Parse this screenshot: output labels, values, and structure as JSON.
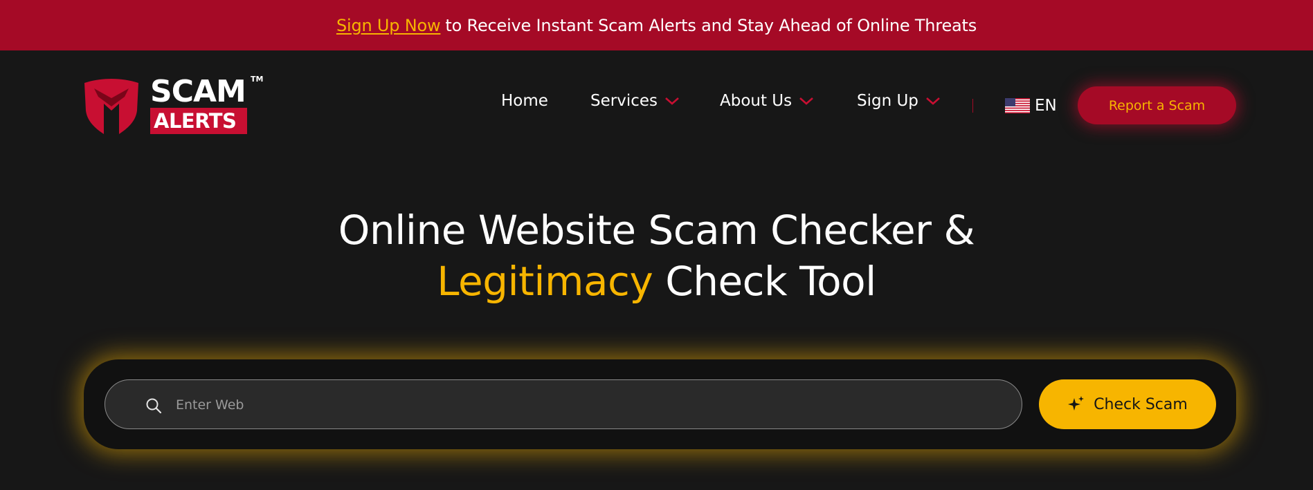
{
  "announcement": {
    "link_text": "Sign Up Now",
    "text": "to Receive Instant Scam Alerts and Stay Ahead of Online Threats"
  },
  "logo": {
    "line1": "SCAM",
    "line2": "ALERTS",
    "trademark": "TM"
  },
  "nav": {
    "items": [
      {
        "label": "Home",
        "has_dropdown": false
      },
      {
        "label": "Services",
        "has_dropdown": true
      },
      {
        "label": "About Us",
        "has_dropdown": true
      },
      {
        "label": "Sign Up",
        "has_dropdown": true
      }
    ],
    "language": "EN",
    "report_button": "Report a Scam"
  },
  "hero": {
    "line1": "Online Website Scam Checker &",
    "highlight": "Legitimacy",
    "line2_rest": "Check Tool"
  },
  "search": {
    "placeholder": "Enter Web",
    "value": "",
    "button_label": "Check Scam"
  },
  "colors": {
    "primary_red": "#a50a26",
    "accent_yellow": "#f7b500",
    "background": "#171717"
  }
}
